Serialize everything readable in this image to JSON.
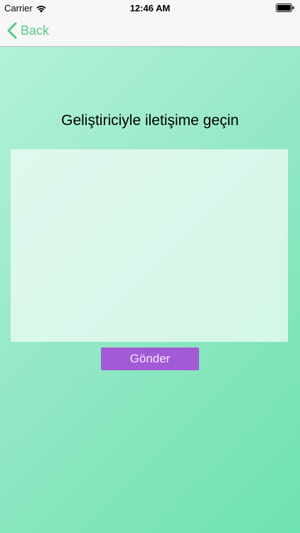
{
  "status_bar": {
    "carrier": "Carrier",
    "time": "12:46 AM",
    "wifi_icon": "wifi-icon",
    "battery_icon": "battery-icon"
  },
  "nav": {
    "back_label": "Back",
    "back_icon": "chevron-left-icon"
  },
  "main": {
    "title": "Geliştiriciyle iletişime geçin",
    "message_value": "",
    "send_label": "Gönder"
  },
  "colors": {
    "accent": "#56c98a",
    "button": "#a35ad6",
    "background_start": "#b3f2d8",
    "background_end": "#6ee2b0"
  }
}
